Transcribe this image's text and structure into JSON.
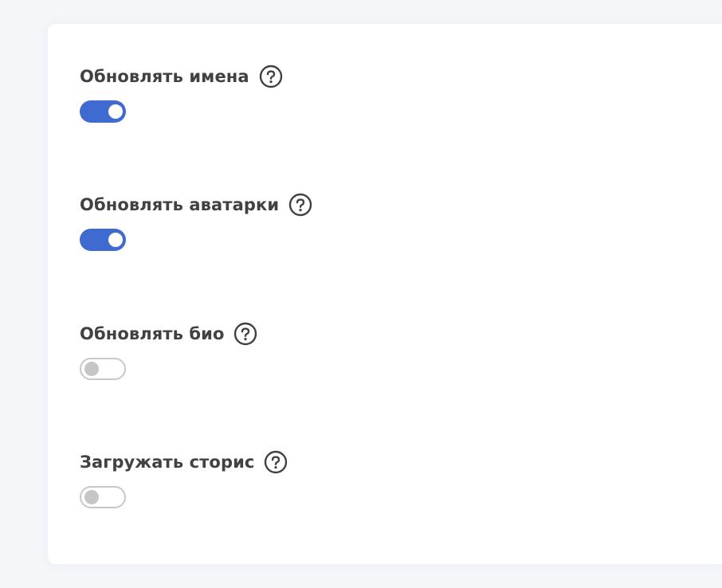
{
  "settings": [
    {
      "label": "Обновлять имена",
      "enabled": true
    },
    {
      "label": "Обновлять аватарки",
      "enabled": true
    },
    {
      "label": "Обновлять био",
      "enabled": false
    },
    {
      "label": "Загружать сторис",
      "enabled": false
    }
  ],
  "colors": {
    "accent": "#3f6bd0",
    "text": "#414141",
    "toggle_off_border": "#c8c8c8",
    "toggle_off_knob": "#c6c6c6",
    "page_background": "#f4f6fa"
  },
  "icons": {
    "help": "question-circle-icon"
  }
}
